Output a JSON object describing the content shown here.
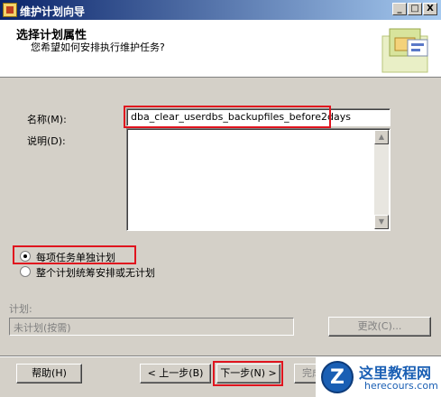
{
  "window": {
    "title": "维护计划向导",
    "minimize": "_",
    "maximize": "□",
    "close": "X"
  },
  "header": {
    "title": "选择计划属性",
    "subtitle": "您希望如何安排执行维护任务?"
  },
  "form": {
    "name_label": "名称(M):",
    "name_value": "dba_clear_userdbs_backupfiles_before2days",
    "desc_label": "说明(D):",
    "desc_value": "",
    "radio_separate": "每项任务单独计划",
    "radio_single": "整个计划统筹安排或无计划",
    "radio_selected": "separate",
    "schedule_label": "计划:",
    "schedule_value": "未计划(按需)",
    "change_button": "更改(C)..."
  },
  "footer": {
    "help": "帮助(H)",
    "back": "< 上一步(B)",
    "next": "下一步(N) >",
    "finish": "完成"
  },
  "watermark": {
    "cn": "这里教程网",
    "en": "herecours.com",
    "logo": "Z"
  },
  "colors": {
    "highlight": "#e0141e",
    "titlebar": "#0a246a"
  }
}
